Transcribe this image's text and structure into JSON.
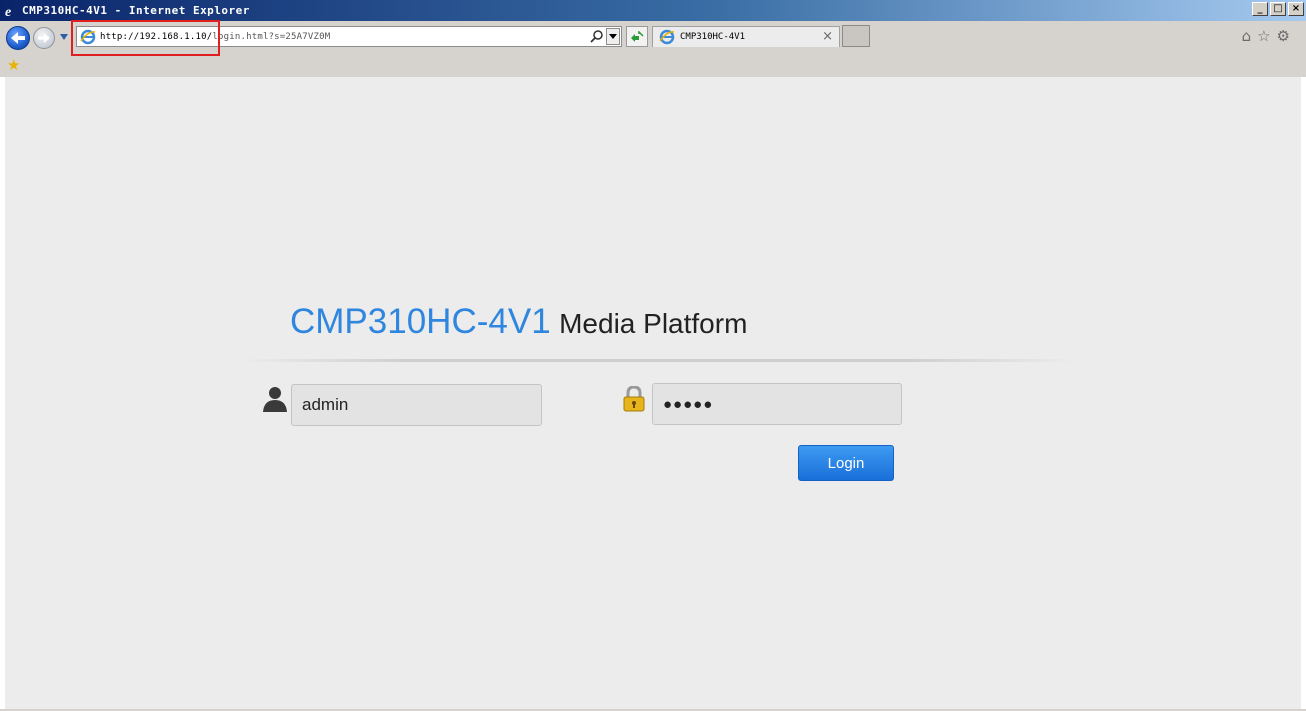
{
  "window": {
    "title": "CMP310HC-4V1 - Internet Explorer",
    "controls": {
      "minimize": "_",
      "maximize": "□",
      "close": "×"
    }
  },
  "browser": {
    "url_domain": "http://192.168.1.10/",
    "url_path": "login.html?s=25A7VZ0M",
    "tab_title": "CMP310HC-4V1",
    "tab_close": "×",
    "icons": {
      "back": "back-arrow-icon",
      "forward": "forward-arrow-icon",
      "home": "⌂",
      "favorites": "☆",
      "tools": "⚙",
      "add_favorite": "★"
    }
  },
  "login": {
    "model": "CMP310HC-4V1",
    "subtitle": "Media Platform",
    "username": "admin",
    "password_masked": "●●●●●",
    "button_label": "Login"
  },
  "colors": {
    "accent": "#2e86df",
    "button": "#1a6fd8",
    "page_background": "#ececec",
    "highlight": "#e02020"
  }
}
